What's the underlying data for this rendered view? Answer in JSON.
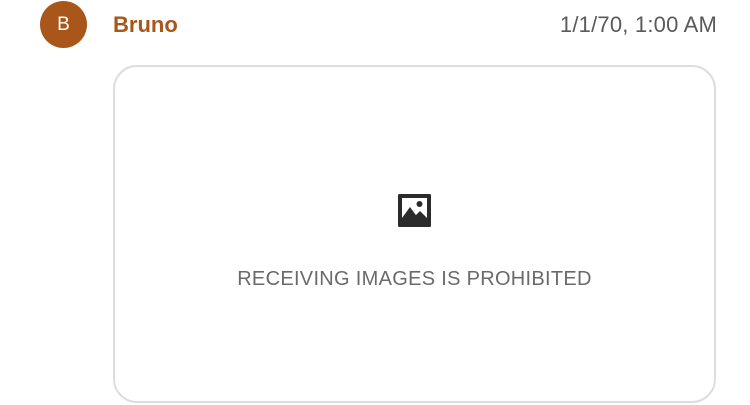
{
  "message": {
    "avatar_initial": "B",
    "sender_name": "Bruno",
    "timestamp": "1/1/70, 1:00 AM",
    "attachment": {
      "icon": "image-icon",
      "notice": "RECEIVING IMAGES IS PROHIBITED"
    }
  },
  "colors": {
    "accent": "#a9561b",
    "timestamp_text": "#5a5a5a",
    "notice_text": "#6a6a6a",
    "border": "#dddddd",
    "icon": "#2b2b2b"
  }
}
